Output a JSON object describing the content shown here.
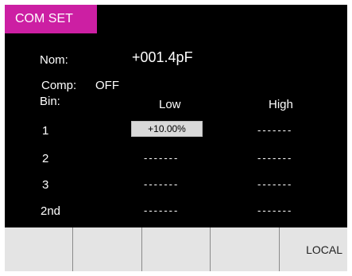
{
  "tab": {
    "label": "COM SET"
  },
  "nom": {
    "label": "Nom:",
    "value": "+001.4pF"
  },
  "comp": {
    "label": "Comp:",
    "value": "OFF"
  },
  "bin": {
    "label": "Bin:",
    "low_header": "Low",
    "high_header": "High",
    "rows": [
      {
        "label": "1",
        "low": "+10.00%",
        "high": "-------"
      },
      {
        "label": "2",
        "low": "-------",
        "high": "-------"
      },
      {
        "label": "3",
        "low": "-------",
        "high": "-------"
      },
      {
        "label": "2nd",
        "low": "-------",
        "high": "-------"
      }
    ]
  },
  "softkeys": [
    "",
    "",
    "",
    "",
    "LOCAL"
  ],
  "colors": {
    "tab": "#cc1fa3",
    "background": "#000000",
    "softkey": "#e4e4e4"
  }
}
